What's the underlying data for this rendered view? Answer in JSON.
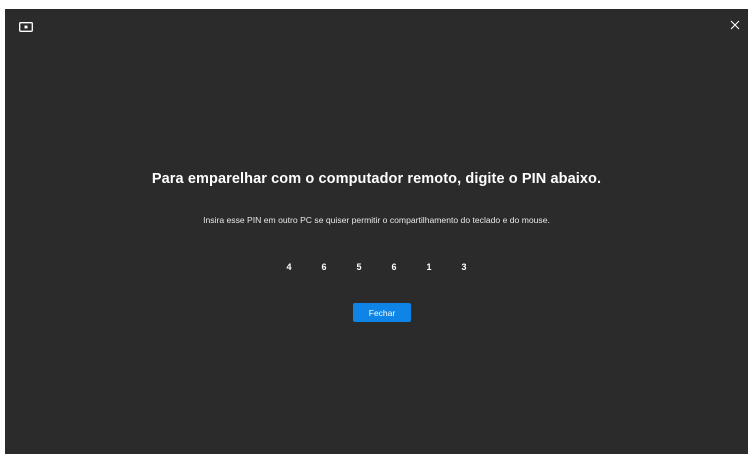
{
  "window": {
    "app_icon": "monitor-icon",
    "close_icon": "close-icon"
  },
  "dialog": {
    "title": "Para emparelhar com o computador remoto, digite o PIN abaixo.",
    "subtitle": "Insira esse PIN em outro PC se quiser permitir o compartilhamento do teclado e do mouse.",
    "pin": [
      "4",
      "6",
      "5",
      "6",
      "1",
      "3"
    ],
    "close_button_label": "Fechar"
  },
  "colors": {
    "background": "#2b2b2b",
    "accent": "#0d84e6",
    "text": "#ffffff"
  }
}
